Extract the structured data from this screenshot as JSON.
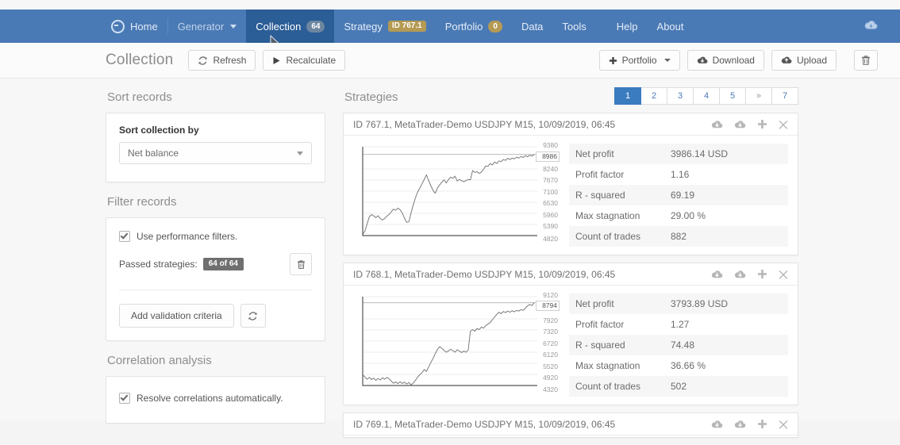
{
  "navbar": {
    "brand_icon": "circle-minus-icon",
    "items": [
      {
        "label": "Home",
        "state": "normal",
        "badge": null,
        "badge_type": null,
        "caret": false
      },
      {
        "label": "Generator",
        "state": "dim",
        "badge": null,
        "badge_type": null,
        "caret": true
      },
      {
        "label": "Collection",
        "state": "active",
        "badge": "64",
        "badge_type": "count",
        "caret": false
      },
      {
        "label": "Strategy",
        "state": "normal",
        "badge": "ID 767.1",
        "badge_type": "id",
        "caret": false
      },
      {
        "label": "Portfolio",
        "state": "normal",
        "badge": "0",
        "badge_type": "zero",
        "caret": false
      },
      {
        "label": "Data",
        "state": "normal",
        "badge": null,
        "badge_type": null,
        "caret": false
      },
      {
        "label": "Tools",
        "state": "normal",
        "badge": null,
        "badge_type": null,
        "caret": false
      },
      {
        "label": "Help",
        "state": "normal",
        "badge": null,
        "badge_type": null,
        "caret": false
      },
      {
        "label": "About",
        "state": "normal",
        "badge": null,
        "badge_type": null,
        "caret": false
      }
    ],
    "right_icon": "cloud-icon",
    "bg_color": "#4a7ab5",
    "active_bg_color": "#2b5d96"
  },
  "subheader": {
    "title": "Collection",
    "refresh_label": "Refresh",
    "recalculate_label": "Recalculate",
    "portfolio_label": "Portfolio",
    "download_label": "Download",
    "upload_label": "Upload",
    "delete_label": ""
  },
  "sidebar": {
    "sort": {
      "section_title": "Sort records",
      "field_label": "Sort collection by",
      "selected_value": "Net balance"
    },
    "filter": {
      "section_title": "Filter records",
      "use_filters_label": "Use performance filters.",
      "use_filters_checked": true,
      "passed_label": "Passed strategies:",
      "passed_badge": "64 of 64",
      "add_criteria_label": "Add validation criteria"
    },
    "correlation": {
      "section_title": "Correlation analysis",
      "resolve_label": "Resolve correlations automatically.",
      "resolve_checked": true
    }
  },
  "strategies": {
    "section_title": "Strategies",
    "pagination": {
      "pages": [
        "1",
        "2",
        "3",
        "4",
        "5",
        "»",
        "7"
      ],
      "active_index": 0,
      "active_color": "#3b7bbf"
    },
    "stat_keys": [
      "Net profit",
      "Profit factor",
      "R - squared",
      "Max stagnation",
      "Count of trades"
    ],
    "cards": [
      {
        "title": "ID 767.1, MetaTrader-Demo USDJPY M15, 10/09/2019, 06:45",
        "stats": [
          "3986.14 USD",
          "1.16",
          "69.19",
          "29.00 %",
          "882"
        ],
        "chart": {
          "y_ticks": [
            "9380",
            "8240",
            "7670",
            "7100",
            "6530",
            "5960",
            "5390",
            "4820"
          ],
          "highlight_value": "8986",
          "ymin": 4820,
          "ymax": 9380
        }
      },
      {
        "title": "ID 768.1, MetaTrader-Demo USDJPY M15, 10/09/2019, 06:45",
        "stats": [
          "3793.89 USD",
          "1.27",
          "74.48",
          "36.66 %",
          "502"
        ],
        "chart": {
          "y_ticks": [
            "9120",
            "7920",
            "7320",
            "6720",
            "6120",
            "5520",
            "4920",
            "4320"
          ],
          "highlight_value": "8794",
          "ymin": 4320,
          "ymax": 9120
        }
      },
      {
        "title": "ID 769.1, MetaTrader-Demo USDJPY M15, 10/09/2019, 06:45",
        "stats": [],
        "chart": null
      }
    ],
    "card_action_icons": [
      "cloud-download-icon",
      "cloud-download-icon",
      "plus-icon",
      "close-icon"
    ]
  },
  "chart_data": [
    {
      "type": "line",
      "title": "Equity curve ID 767.1",
      "xlabel": "",
      "ylabel": "",
      "ylim": [
        4820,
        9380
      ],
      "grid": true,
      "legend": "none",
      "y_tick_labels": [
        "9380",
        "8240",
        "7670",
        "7100",
        "6530",
        "5960",
        "5390",
        "4820"
      ],
      "final_value": 8986,
      "values": [
        4860,
        5050,
        5420,
        5780,
        5900,
        5830,
        5740,
        5840,
        5700,
        5620,
        5700,
        5820,
        5900,
        6040,
        6180,
        6120,
        6230,
        6150,
        5980,
        5720,
        5500,
        5530,
        5980,
        6400,
        6760,
        7060,
        7260,
        7480,
        7700,
        7940,
        7640,
        7380,
        7140,
        6990,
        7260,
        7420,
        7560,
        7680,
        7520,
        7690,
        7820,
        7760,
        7870,
        7620,
        7700,
        7640,
        7580,
        7640,
        7700,
        7680,
        8160,
        8060,
        8100,
        8010,
        8080,
        8220,
        8400,
        8370,
        8520,
        8440,
        8600,
        8520,
        8650,
        8620,
        8720,
        8680,
        8790,
        8720,
        8800,
        8760,
        8840,
        8800,
        8880,
        8830,
        8920,
        8870,
        8940,
        8900,
        8986
      ]
    },
    {
      "type": "line",
      "title": "Equity curve ID 768.1",
      "xlabel": "",
      "ylabel": "",
      "ylim": [
        4320,
        9120
      ],
      "grid": true,
      "legend": "none",
      "y_tick_labels": [
        "9120",
        "7920",
        "7320",
        "6720",
        "6120",
        "5520",
        "4920",
        "4320"
      ],
      "final_value": 8794,
      "values": [
        4900,
        4780,
        4660,
        4760,
        4640,
        4720,
        4600,
        4700,
        4620,
        4740,
        4660,
        4760,
        4680,
        4560,
        4440,
        4520,
        4420,
        4520,
        4430,
        4500,
        4400,
        4480,
        4360,
        4450,
        4600,
        4780,
        4900,
        5020,
        5180,
        5080,
        5320,
        5560,
        5780,
        6040,
        6260,
        6420,
        6330,
        6220,
        6120,
        6180,
        6280,
        6200,
        6120,
        6250,
        6180,
        6100,
        6180,
        6120,
        6230,
        7250,
        7340,
        7260,
        7400,
        7340,
        7480,
        7420,
        7560,
        7640,
        7720,
        7880,
        8020,
        8160,
        8280,
        8200,
        8320,
        8260,
        8340,
        8280,
        8360,
        8300,
        8380,
        8340,
        8420,
        8380,
        8500,
        8620,
        8700,
        8640,
        8794
      ]
    }
  ]
}
